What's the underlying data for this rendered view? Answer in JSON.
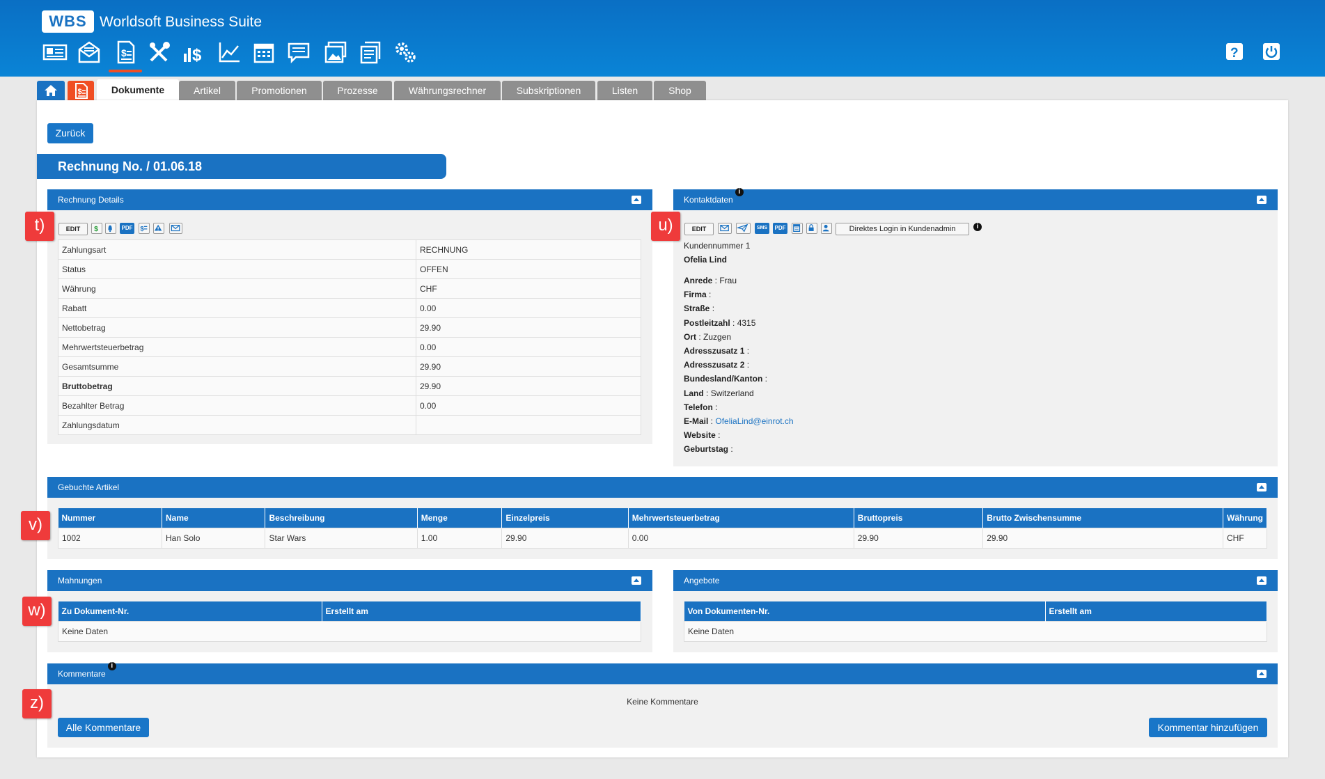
{
  "app": {
    "logo": "WBS",
    "name": "Worldsoft Business Suite"
  },
  "modules": [
    "contacts-icon",
    "mail-icon",
    "documents-icon",
    "tools-icon",
    "finance-icon",
    "statistics-icon",
    "calendar-icon",
    "chat-icon",
    "gallery-icon",
    "invoice-icon",
    "settings-icon"
  ],
  "header_right": [
    "help-icon",
    "power-icon"
  ],
  "tabs": [
    "Dokumente",
    "Artikel",
    "Promotionen",
    "Prozesse",
    "Währungsrechner",
    "Subskriptionen",
    "Listen",
    "Shop"
  ],
  "back_button": "Zurück",
  "page_title": "Rechnung No. / 01.06.18",
  "details": {
    "title": "Rechnung Details",
    "edit_label": "EDIT",
    "pdf_label": "PDF",
    "rows": [
      {
        "label": "Zahlungsart",
        "value": "RECHNUNG"
      },
      {
        "label": "Status",
        "value": "OFFEN"
      },
      {
        "label": "Währung",
        "value": "CHF"
      },
      {
        "label": "Rabatt",
        "value": "0.00"
      },
      {
        "label": "Nettobetrag",
        "value": "29.90"
      },
      {
        "label": "Mehrwertsteuerbetrag",
        "value": "0.00"
      },
      {
        "label": "Gesamtsumme",
        "value": "29.90"
      },
      {
        "label": "Bruttobetrag",
        "value": "29.90"
      },
      {
        "label": "Bezahlter Betrag",
        "value": "0.00"
      },
      {
        "label": "Zahlungsdatum",
        "value": ""
      }
    ]
  },
  "contact": {
    "title": "Kontaktdaten",
    "edit_label": "EDIT",
    "sms_label": "SMS",
    "pdf_label": "PDF",
    "login_button": "Direktes Login in Kundenadmin",
    "customer_number": "Kundennummer 1",
    "name": "Ofelia Lind",
    "fields": [
      {
        "label": "Anrede",
        "value": "Frau"
      },
      {
        "label": "Firma",
        "value": ""
      },
      {
        "label": "Straße",
        "value": ""
      },
      {
        "label": "Postleitzahl",
        "value": "4315"
      },
      {
        "label": "Ort",
        "value": "Zuzgen"
      },
      {
        "label": "Adresszusatz 1",
        "value": ""
      },
      {
        "label": "Adresszusatz 2",
        "value": ""
      },
      {
        "label": "Bundesland/Kanton",
        "value": ""
      },
      {
        "label": "Land",
        "value": "Switzerland"
      },
      {
        "label": "Telefon",
        "value": ""
      },
      {
        "label": "E-Mail",
        "value": "OfeliaLind@einrot.ch"
      },
      {
        "label": "Website",
        "value": ""
      },
      {
        "label": "Geburtstag",
        "value": ""
      }
    ]
  },
  "articles": {
    "title": "Gebuchte Artikel",
    "columns": [
      "Nummer",
      "Name",
      "Beschreibung",
      "Menge",
      "Einzelpreis",
      "Mehrwertsteuerbetrag",
      "Bruttopreis",
      "Brutto Zwischensumme",
      "Währung"
    ],
    "rows": [
      [
        "1002",
        "Han Solo",
        "Star Wars",
        "1.00",
        "29.90",
        "0.00",
        "29.90",
        "29.90",
        "CHF"
      ]
    ]
  },
  "reminders": {
    "title": "Mahnungen",
    "columns": [
      "Zu Dokument-Nr.",
      "Erstellt am"
    ],
    "empty": "Keine Daten"
  },
  "offers": {
    "title": "Angebote",
    "columns": [
      "Von Dokumenten-Nr.",
      "Erstellt am"
    ],
    "empty": "Keine Daten"
  },
  "comments": {
    "title": "Kommentare",
    "empty": "Keine Kommentare",
    "all_button": "Alle Kommentare",
    "add_button": "Kommentar hinzufügen"
  },
  "markers": [
    "t)",
    "u)",
    "v)",
    "w)",
    "z)"
  ],
  "colors": {
    "header_blue": "#0a84d6",
    "panel_blue": "#1a72c2",
    "accent_orange": "#f04e23",
    "marker_red": "#ef3b3b",
    "tab_grey": "#8f8f8f"
  }
}
